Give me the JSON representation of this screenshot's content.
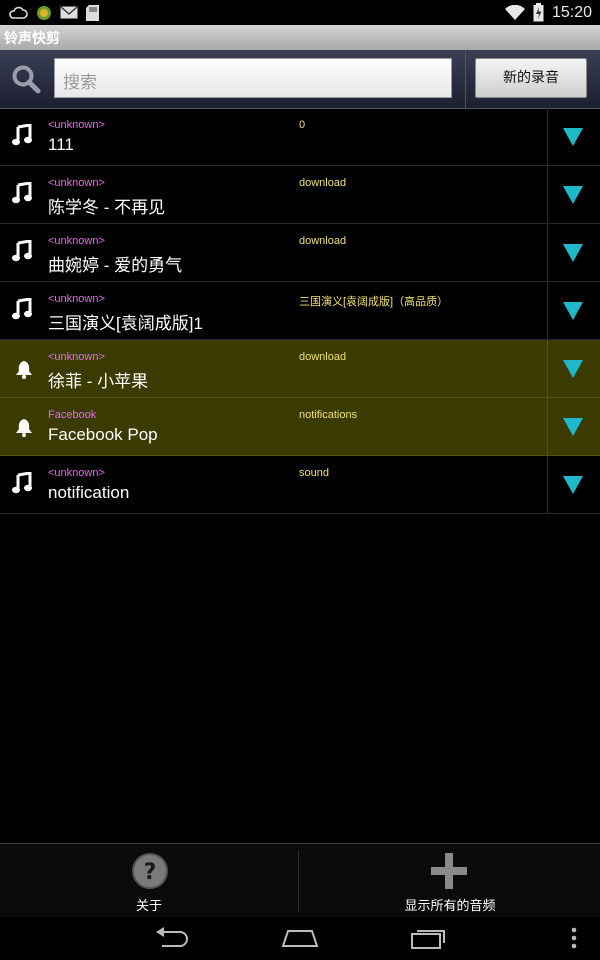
{
  "status_bar": {
    "time": "15:20",
    "left_icons": [
      "cloud-icon",
      "app-icon",
      "mail-icon",
      "sd-card-icon"
    ],
    "right_icons": [
      "wifi-icon",
      "battery-icon"
    ]
  },
  "app": {
    "title": "铃声快剪"
  },
  "search": {
    "placeholder": "搜索",
    "new_recording_label": "新的录音"
  },
  "ringtones": [
    {
      "icon": "music-note-icon",
      "artist": "<unknown>",
      "title": "111",
      "album": "0",
      "highlighted": false
    },
    {
      "icon": "music-note-icon",
      "artist": "<unknown>",
      "title": "陈学冬 - 不再见",
      "album": "download",
      "highlighted": false
    },
    {
      "icon": "music-note-icon",
      "artist": "<unknown>",
      "title": "曲婉婷 - 爱的勇气",
      "album": "download",
      "highlighted": false
    },
    {
      "icon": "music-note-icon",
      "artist": "<unknown>",
      "title": "三国演义[袁阔成版]1",
      "album": "三国演义[袁阔成版]（高品质）",
      "highlighted": false
    },
    {
      "icon": "bell-icon",
      "artist": "<unknown>",
      "title": "徐菲 - 小苹果",
      "album": "download",
      "highlighted": true
    },
    {
      "icon": "bell-icon",
      "artist": "Facebook",
      "title": "Facebook Pop",
      "album": "notifications",
      "highlighted": true
    },
    {
      "icon": "music-note-icon",
      "artist": "<unknown>",
      "title": "notification",
      "album": "sound",
      "highlighted": false
    }
  ],
  "bottom_bar": {
    "about_label": "关于",
    "show_all_label": "显示所有的音频"
  },
  "colors": {
    "artist": "#e16ee1",
    "album": "#f0e06c",
    "highlight_row": "#3b3b00",
    "menu_arrow": "#1fb8c9"
  }
}
